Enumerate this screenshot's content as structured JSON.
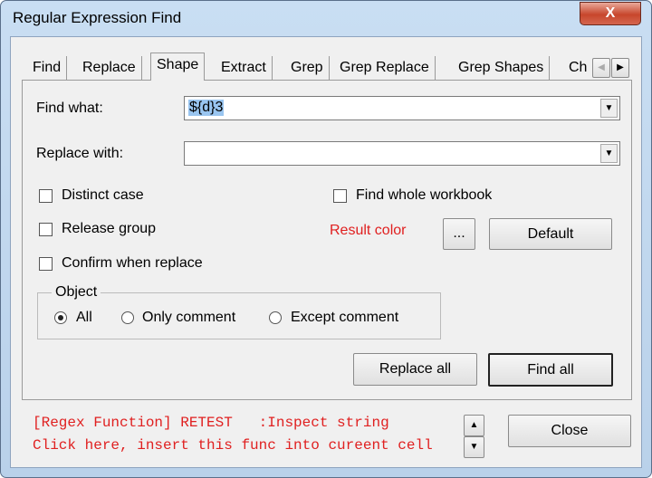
{
  "window": {
    "title": "Regular Expression Find",
    "close_icon": "close-icon"
  },
  "tabs": [
    {
      "label": "Find"
    },
    {
      "label": "Replace"
    },
    {
      "label": "Shape",
      "selected": true
    },
    {
      "label": "Extract"
    },
    {
      "label": "Grep"
    },
    {
      "label": "Grep Replace"
    },
    {
      "label": "Grep Shapes"
    },
    {
      "label": "Ch"
    }
  ],
  "form": {
    "find_label": "Find what:",
    "find_value": "${d}3",
    "replace_label": "Replace with:",
    "replace_value": "",
    "distinct_case": "Distinct case",
    "release_group": "Release group",
    "confirm_replace": "Confirm when replace",
    "whole_workbook": "Find whole workbook",
    "result_color": "Result color",
    "result_color_hex": "#e02020",
    "ellipsis": "...",
    "default": "Default"
  },
  "object": {
    "legend": "Object",
    "options": [
      {
        "label": "All",
        "checked": true
      },
      {
        "label": "Only comment",
        "checked": false
      },
      {
        "label": "Except comment",
        "checked": false
      }
    ]
  },
  "buttons": {
    "replace_all": "Replace all",
    "find_all": "Find all",
    "close": "Close"
  },
  "hint": {
    "line1": "[Regex Function] RETEST   :Inspect string",
    "line2": "Click here, insert this func into cureent cell"
  }
}
